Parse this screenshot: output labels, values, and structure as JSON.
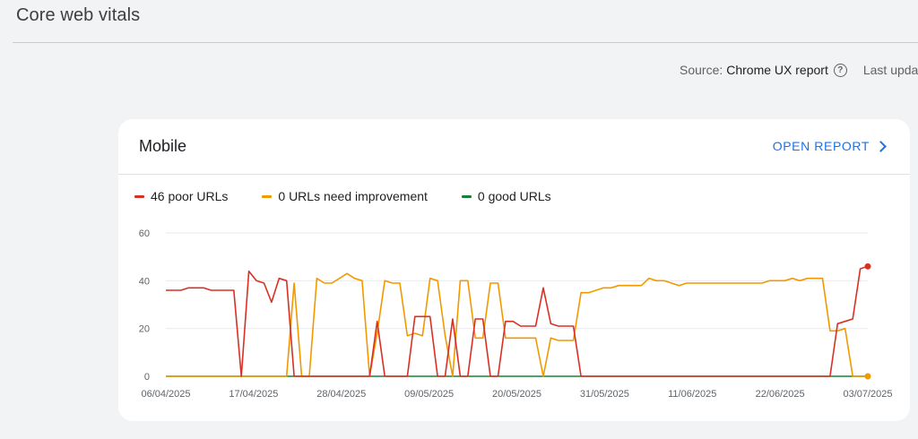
{
  "page": {
    "title": "Core web vitals",
    "source_label": "Source:",
    "source_value": "Chrome UX report",
    "help_glyph": "?",
    "last_updated": "Last upda"
  },
  "card": {
    "title": "Mobile",
    "open_report": "OPEN REPORT"
  },
  "colors": {
    "poor": "#d93025",
    "needs_improvement": "#f29900",
    "good": "#188038",
    "accent": "#1a73e8"
  },
  "chart_data": {
    "type": "line",
    "x_tick_labels": [
      "06/04/2025",
      "17/04/2025",
      "28/04/2025",
      "09/05/2025",
      "20/05/2025",
      "31/05/2025",
      "11/06/2025",
      "22/06/2025",
      "03/07/2025"
    ],
    "x_start": "06/04/2025",
    "x_end": "03/07/2025",
    "ylim": [
      0,
      60
    ],
    "yticks": [
      0,
      20,
      40,
      60
    ],
    "grid": true,
    "legend_position": "top-left",
    "series": [
      {
        "name": "46 poor URLs",
        "color": "#d93025",
        "values": [
          36,
          36,
          36,
          37,
          37,
          37,
          36,
          36,
          36,
          36,
          0,
          44,
          40,
          39,
          31,
          41,
          40,
          0,
          0,
          0,
          0,
          0,
          0,
          0,
          0,
          0,
          0,
          0,
          23,
          0,
          0,
          0,
          0,
          25,
          25,
          25,
          0,
          0,
          24,
          0,
          0,
          24,
          24,
          0,
          0,
          23,
          23,
          21,
          21,
          21,
          37,
          22,
          21,
          21,
          21,
          0,
          0,
          0,
          0,
          0,
          0,
          0,
          0,
          0,
          0,
          0,
          0,
          0,
          0,
          0,
          0,
          0,
          0,
          0,
          0,
          0,
          0,
          0,
          0,
          0,
          0,
          0,
          0,
          0,
          0,
          0,
          0,
          0,
          0,
          22,
          23,
          24,
          45,
          46
        ]
      },
      {
        "name": "0 URLs need improvement",
        "color": "#f29900",
        "values": [
          0,
          0,
          0,
          0,
          0,
          0,
          0,
          0,
          0,
          0,
          0,
          0,
          0,
          0,
          0,
          0,
          0,
          39,
          0,
          0,
          41,
          39,
          39,
          41,
          43,
          41,
          40,
          0,
          18,
          40,
          39,
          39,
          17,
          18,
          17,
          41,
          40,
          17,
          0,
          40,
          40,
          16,
          16,
          39,
          39,
          16,
          16,
          16,
          16,
          16,
          0,
          16,
          15,
          15,
          15,
          35,
          35,
          36,
          37,
          37,
          38,
          38,
          38,
          38,
          41,
          40,
          40,
          39,
          38,
          39,
          39,
          39,
          39,
          39,
          39,
          39,
          39,
          39,
          39,
          39,
          40,
          40,
          40,
          41,
          40,
          41,
          41,
          41,
          19,
          19,
          20,
          0,
          0,
          0
        ]
      },
      {
        "name": "0 good URLs",
        "color": "#188038",
        "values": [
          0,
          0,
          0,
          0,
          0,
          0,
          0,
          0,
          0,
          0,
          0,
          0,
          0,
          0,
          0,
          0,
          0,
          0,
          0,
          0,
          0,
          0,
          0,
          0,
          0,
          0,
          0,
          0,
          0,
          0,
          0,
          0,
          0,
          0,
          0,
          0,
          0,
          0,
          0,
          0,
          0,
          0,
          0,
          0,
          0,
          0,
          0,
          0,
          0,
          0,
          0,
          0,
          0,
          0,
          0,
          0,
          0,
          0,
          0,
          0,
          0,
          0,
          0,
          0,
          0,
          0,
          0,
          0,
          0,
          0,
          0,
          0,
          0,
          0,
          0,
          0,
          0,
          0,
          0,
          0,
          0,
          0,
          0,
          0,
          0,
          0,
          0,
          0,
          0,
          0,
          0,
          0,
          0,
          0
        ]
      }
    ]
  }
}
